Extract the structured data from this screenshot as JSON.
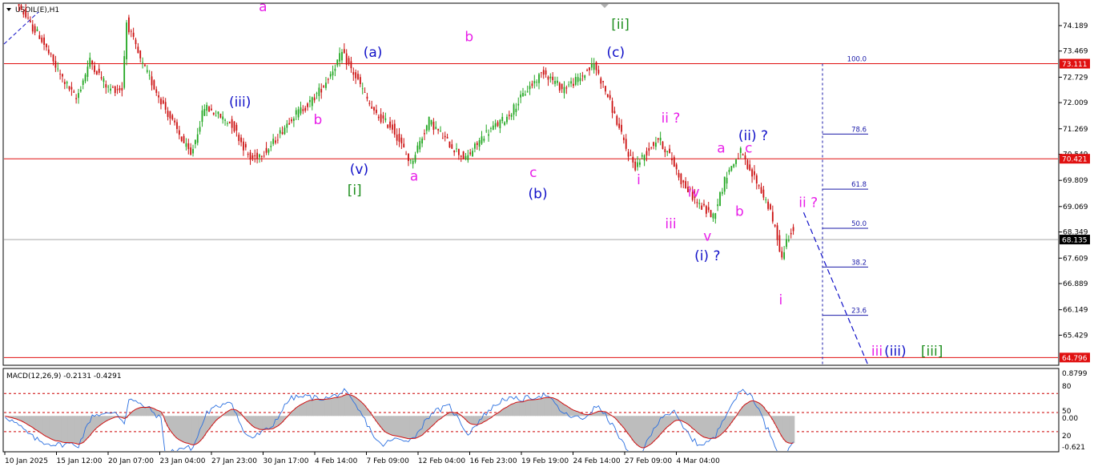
{
  "chart_data": {
    "type": "candlestick",
    "symbol_header": "USOIL(E),H1",
    "colors": {
      "bull": "#22a722",
      "bear": "#cc1111",
      "hline": "#e01010",
      "grid_dash": "#cc0000",
      "magenta": "#e81ee8",
      "blue": "#1010c8",
      "green": "#1f8f1f",
      "fib": "#1a1aa8"
    },
    "price_axis": {
      "ylim": [
        64.6,
        74.8
      ],
      "ticks": [
        "74.189",
        "73.469",
        "72.729",
        "72.009",
        "71.269",
        "70.549",
        "69.809",
        "69.069",
        "68.349",
        "67.609",
        "66.889",
        "66.149",
        "65.429"
      ]
    },
    "time_axis": {
      "labels": [
        "10 Jan 2025",
        "15 Jan 12:00",
        "20 Jan 07:00",
        "23 Jan 04:00",
        "27 Jan 23:00",
        "30 Jan 17:00",
        "4 Feb 14:00",
        "7 Feb 09:00",
        "12 Feb 04:00",
        "16 Feb 23:00",
        "19 Feb 19:00",
        "24 Feb 14:00",
        "27 Feb 09:00",
        "4 Mar 04:00"
      ]
    },
    "price_path": [
      [
        0,
        75.5
      ],
      [
        3,
        74.9
      ],
      [
        6,
        74.2
      ],
      [
        8,
        73.9
      ],
      [
        12,
        72.9
      ],
      [
        16,
        72.1
      ],
      [
        19,
        73.2
      ],
      [
        23,
        72.4
      ],
      [
        26,
        72.4
      ],
      [
        27,
        74.3
      ],
      [
        30,
        73.2
      ],
      [
        36,
        71.7
      ],
      [
        41,
        70.5
      ],
      [
        44,
        71.9
      ],
      [
        50,
        71.4
      ],
      [
        54,
        70.4
      ],
      [
        58,
        70.7
      ],
      [
        63,
        71.6
      ],
      [
        67,
        72.0
      ],
      [
        70,
        72.5
      ],
      [
        74,
        73.4
      ],
      [
        78,
        72.5
      ],
      [
        81,
        71.7
      ],
      [
        85,
        71.3
      ],
      [
        89,
        70.3
      ],
      [
        93,
        71.5
      ],
      [
        97,
        70.9
      ],
      [
        101,
        70.4
      ],
      [
        105,
        71.1
      ],
      [
        110,
        71.6
      ],
      [
        114,
        72.3
      ],
      [
        118,
        72.9
      ],
      [
        122,
        72.4
      ],
      [
        126,
        72.7
      ],
      [
        129,
        73.1
      ],
      [
        132,
        72.2
      ],
      [
        136,
        70.7
      ],
      [
        138,
        70.2
      ],
      [
        141,
        70.7
      ],
      [
        143,
        71.0
      ],
      [
        146,
        70.4
      ],
      [
        148,
        69.8
      ],
      [
        152,
        69.1
      ],
      [
        155,
        68.8
      ],
      [
        158,
        70.0
      ],
      [
        161,
        70.6
      ],
      [
        163,
        70.0
      ],
      [
        164,
        69.9
      ],
      [
        167,
        69.1
      ],
      [
        169,
        68.2
      ],
      [
        170,
        67.6
      ],
      [
        171,
        68.1
      ],
      [
        172,
        68.4
      ]
    ],
    "hlines": [
      {
        "price": 73.111,
        "label": "73.111"
      },
      {
        "price": 70.421,
        "label": "70.421"
      },
      {
        "price": 64.796,
        "label": "64.796"
      }
    ],
    "current_price": {
      "price": 68.135,
      "label": "68.135"
    },
    "fib_levels": [
      {
        "label": "100.0",
        "price": 73.111
      },
      {
        "label": "78.6",
        "price": 71.12
      },
      {
        "label": "61.8",
        "price": 69.56
      },
      {
        "label": "50.0",
        "price": 68.453
      },
      {
        "label": "38.2",
        "price": 67.356
      },
      {
        "label": "23.6",
        "price": 65.99
      }
    ],
    "projection": [
      [
        174,
        68.9
      ],
      [
        188,
        64.6
      ]
    ],
    "wave_labels": [
      {
        "text": "a",
        "bar": 56,
        "price": 74.6,
        "color": "magenta"
      },
      {
        "text": "(iii)",
        "bar": 51,
        "price": 71.9,
        "color": "blue"
      },
      {
        "text": "b",
        "bar": 68,
        "price": 71.4,
        "color": "magenta"
      },
      {
        "text": "(a)",
        "bar": 80,
        "price": 73.3,
        "color": "blue"
      },
      {
        "text": "(v)",
        "bar": 77,
        "price": 70.0,
        "color": "blue"
      },
      {
        "text": "[i]",
        "bar": 76,
        "price": 69.4,
        "color": "green"
      },
      {
        "text": "a",
        "bar": 89,
        "price": 69.8,
        "color": "magenta"
      },
      {
        "text": "b",
        "bar": 101,
        "price": 73.75,
        "color": "magenta"
      },
      {
        "text": "c",
        "bar": 115,
        "price": 69.9,
        "color": "magenta"
      },
      {
        "text": "(b)",
        "bar": 116,
        "price": 69.3,
        "color": "blue"
      },
      {
        "text": "[ii]",
        "bar": 134,
        "price": 74.1,
        "color": "green"
      },
      {
        "text": "(c)",
        "bar": 133,
        "price": 73.3,
        "color": "blue"
      },
      {
        "text": "ii ?",
        "bar": 145,
        "price": 71.45,
        "color": "magenta"
      },
      {
        "text": "i",
        "bar": 138,
        "price": 69.7,
        "color": "magenta"
      },
      {
        "text": "iii",
        "bar": 145,
        "price": 68.45,
        "color": "magenta"
      },
      {
        "text": "iv",
        "bar": 150,
        "price": 69.35,
        "color": "magenta"
      },
      {
        "text": "v",
        "bar": 153,
        "price": 68.1,
        "color": "magenta"
      },
      {
        "text": "(i) ?",
        "bar": 153,
        "price": 67.55,
        "color": "blue"
      },
      {
        "text": "a",
        "bar": 156,
        "price": 70.6,
        "color": "magenta"
      },
      {
        "text": "b",
        "bar": 160,
        "price": 68.8,
        "color": "magenta"
      },
      {
        "text": "c",
        "bar": 162,
        "price": 70.6,
        "color": "magenta"
      },
      {
        "text": "(ii) ?",
        "bar": 163,
        "price": 70.95,
        "color": "blue"
      },
      {
        "text": "i",
        "bar": 169,
        "price": 66.3,
        "color": "magenta"
      },
      {
        "text": "ii ?",
        "bar": 175,
        "price": 69.05,
        "color": "magenta"
      },
      {
        "text": "iii",
        "bar": 190,
        "price": 64.85,
        "color": "magenta"
      },
      {
        "text": "(iii)",
        "bar": 194,
        "price": 64.85,
        "color": "blue"
      },
      {
        "text": "[iii]",
        "bar": 202,
        "price": 64.85,
        "color": "green"
      }
    ],
    "macd": {
      "header": "MACD(12,26,9) -0.2131 -0.4291",
      "ylim": [
        -0.75,
        1.0
      ],
      "right_labels": [
        "0.8799",
        "80",
        "50",
        "0.00",
        "20",
        "-0.621"
      ],
      "levels": [
        80,
        50,
        20
      ]
    }
  }
}
